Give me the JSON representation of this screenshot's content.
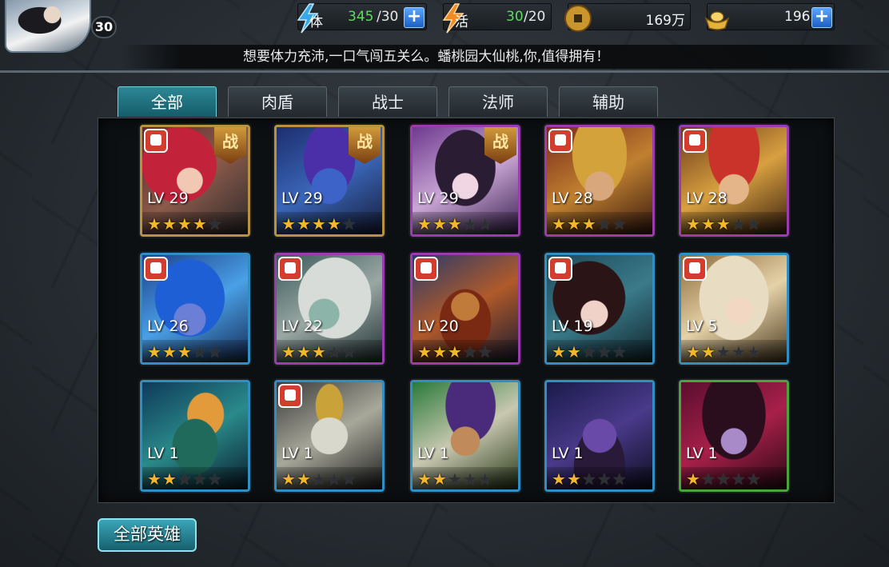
{
  "player": {
    "level": "30"
  },
  "resources": {
    "stamina": {
      "label": "体",
      "current": "345",
      "max": "/30"
    },
    "vitality": {
      "label": "活",
      "current": "30",
      "max": "/20"
    },
    "coins": {
      "value": "169万"
    },
    "ingots": {
      "value": "196"
    }
  },
  "notice": "想要体力充沛,一口气闯五关么。蟠桃园大仙桃,你,值得拥有！",
  "tabs": [
    {
      "label": "全部",
      "active": true
    },
    {
      "label": "肉盾",
      "active": false
    },
    {
      "label": "战士",
      "active": false
    },
    {
      "label": "法师",
      "active": false
    },
    {
      "label": "辅助",
      "active": false
    }
  ],
  "heroes": [
    {
      "level": "LV 29",
      "stars": 4,
      "max_stars": 5,
      "frame": "gold",
      "class_badge": true,
      "zhan_badge": "战",
      "art": "red-hair-warrior"
    },
    {
      "level": "LV 29",
      "stars": 4,
      "max_stars": 5,
      "frame": "gold",
      "class_badge": false,
      "zhan_badge": "战",
      "art": "blue-monkey-king"
    },
    {
      "level": "LV 29",
      "stars": 3,
      "max_stars": 5,
      "frame": "purple",
      "class_badge": false,
      "zhan_badge": "战",
      "art": "dark-hair-sorceress"
    },
    {
      "level": "LV 28",
      "stars": 3,
      "max_stars": 5,
      "frame": "purple",
      "class_badge": true,
      "zhan_badge": "",
      "art": "golden-helmet-general"
    },
    {
      "level": "LV 28",
      "stars": 3,
      "max_stars": 5,
      "frame": "purple",
      "class_badge": true,
      "zhan_badge": "",
      "art": "crowned-king"
    },
    {
      "level": "LV 26",
      "stars": 3,
      "max_stars": 5,
      "frame": "blue",
      "class_badge": true,
      "zhan_badge": "",
      "art": "blue-hair-girl"
    },
    {
      "level": "LV 22",
      "stars": 3,
      "max_stars": 5,
      "frame": "purple",
      "class_badge": true,
      "zhan_badge": "",
      "art": "white-hair-demon"
    },
    {
      "level": "LV 20",
      "stars": 3,
      "max_stars": 5,
      "frame": "purple",
      "class_badge": true,
      "zhan_badge": "",
      "art": "bearded-warrior"
    },
    {
      "level": "LV 19",
      "stars": 2,
      "max_stars": 5,
      "frame": "blue",
      "class_badge": true,
      "zhan_badge": "",
      "art": "dark-hair-maiden"
    },
    {
      "level": "LV 5",
      "stars": 2,
      "max_stars": 5,
      "frame": "blue",
      "class_badge": true,
      "zhan_badge": "",
      "art": "blonde-goddess"
    },
    {
      "level": "LV 1",
      "stars": 2,
      "max_stars": 5,
      "frame": "blue",
      "class_badge": false,
      "zhan_badge": "",
      "art": "sea-dragon"
    },
    {
      "level": "LV 1",
      "stars": 2,
      "max_stars": 5,
      "frame": "blue",
      "class_badge": true,
      "zhan_badge": "",
      "art": "white-elephant"
    },
    {
      "level": "LV 1",
      "stars": 2,
      "max_stars": 5,
      "frame": "blue",
      "class_badge": false,
      "zhan_badge": "",
      "art": "taoist-elder"
    },
    {
      "level": "LV 1",
      "stars": 2,
      "max_stars": 5,
      "frame": "blue",
      "class_badge": false,
      "zhan_badge": "",
      "art": "purple-demon"
    },
    {
      "level": "LV 1",
      "stars": 1,
      "max_stars": 5,
      "frame": "green",
      "class_badge": false,
      "zhan_badge": "",
      "art": "spider-witch"
    }
  ],
  "buttons": {
    "all_heroes": "全部英雄"
  },
  "colors": {
    "accent_teal": "#2d8795",
    "frame_gold": "#b9923f",
    "frame_purple": "#9a3cae",
    "frame_blue": "#2f8fc2",
    "frame_green": "#48a43b",
    "star_on": "#f4b62a",
    "stamina_value": "#5fdc5f"
  }
}
